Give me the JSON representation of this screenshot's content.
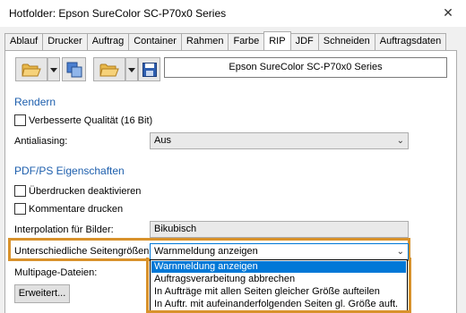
{
  "window": {
    "title": "Hotfolder: Epson SureColor SC-P70x0 Series",
    "close_glyph": "✕"
  },
  "tabs": [
    {
      "label": "Ablauf"
    },
    {
      "label": "Drucker"
    },
    {
      "label": "Auftrag"
    },
    {
      "label": "Container"
    },
    {
      "label": "Rahmen"
    },
    {
      "label": "Farbe"
    },
    {
      "label": "RIP",
      "active": true
    },
    {
      "label": "JDF"
    },
    {
      "label": "Schneiden"
    },
    {
      "label": "Auftragsdaten"
    }
  ],
  "toolbar": {
    "open_icon": "folder-open-icon",
    "copy_icon": "copy-settings-icon",
    "open2_icon": "folder-open-icon",
    "save_icon": "floppy-disk-icon",
    "printer_name": "Epson SureColor SC-P70x0 Series"
  },
  "render": {
    "title": "Rendern",
    "quality_label": "Verbesserte Qualität (16 Bit)",
    "quality_checked": false,
    "antialiasing_label": "Antialiasing:",
    "antialiasing_value": "Aus"
  },
  "pdf": {
    "title": "PDF/PS Eigenschaften",
    "overprint_label": "Überdrucken deaktivieren",
    "overprint_checked": false,
    "comments_label": "Kommentare drucken",
    "comments_checked": false,
    "interpolation_label": "Interpolation für Bilder:",
    "interpolation_value": "Bikubisch",
    "pagesize_label": "Unterschiedliche Seitengrößen:",
    "pagesize_value": "Warnmeldung anzeigen",
    "multipage_label": "Multipage-Dateien:",
    "advanced_button": "Erweitert..."
  },
  "pagesize_options": [
    "Warnmeldung anzeigen",
    "Auftragsverarbeitung abbrechen",
    "In Aufträge mit allen Seiten gleicher Größe aufteilen",
    "In Auftr. mit aufeinanderfolgenden Seiten gl. Größe auft."
  ],
  "colors": {
    "accent_highlight": "#d8922c",
    "section_title": "#1e5fad",
    "selection": "#0078d7"
  }
}
